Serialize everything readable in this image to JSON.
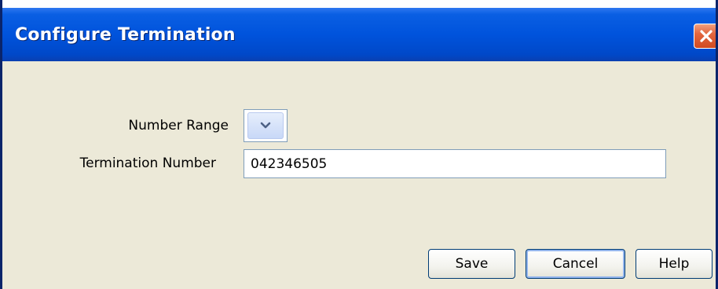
{
  "dialog": {
    "title": "Configure Termination",
    "close_icon": "close-icon"
  },
  "form": {
    "number_range_label": "Number Range",
    "number_range_value": "",
    "termination_number_label": "Termination Number",
    "termination_number_value": "042346505"
  },
  "buttons": {
    "save_label": "Save",
    "cancel_label": "Cancel",
    "help_label": "Help"
  },
  "colors": {
    "titlebar": "#0053dc",
    "dialog_background": "#ece9d8",
    "close_button": "#e2663f"
  }
}
